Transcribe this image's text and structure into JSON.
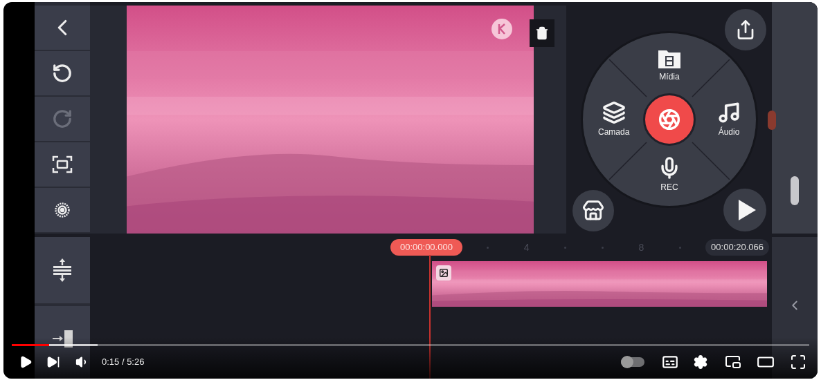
{
  "editor": {
    "toolbar": [
      {
        "kind": "back",
        "disabled": false
      },
      {
        "kind": "undo",
        "disabled": false
      },
      {
        "kind": "redo",
        "disabled": true
      },
      {
        "kind": "fit",
        "disabled": false
      },
      {
        "kind": "settings",
        "disabled": false
      }
    ],
    "timeline_tools": [
      {
        "kind": "track-height"
      },
      {
        "kind": "jump-to-start"
      }
    ],
    "media_wheel": {
      "items": [
        {
          "kind": "media",
          "label": "Mídia"
        },
        {
          "kind": "audio",
          "label": "Áudio"
        },
        {
          "kind": "record",
          "label": "REC"
        },
        {
          "kind": "layer",
          "label": "Camada"
        }
      ]
    },
    "timeline": {
      "current_time": "00:00:00.000",
      "ruler_labels": [
        "4",
        "8"
      ],
      "total_time": "00:00:20.066"
    }
  },
  "player": {
    "progress": {
      "level": 0.047
    },
    "buffered": {
      "level": 0.108
    },
    "time": "0:15 / 5:26",
    "autoplay": {
      "on": false
    }
  }
}
